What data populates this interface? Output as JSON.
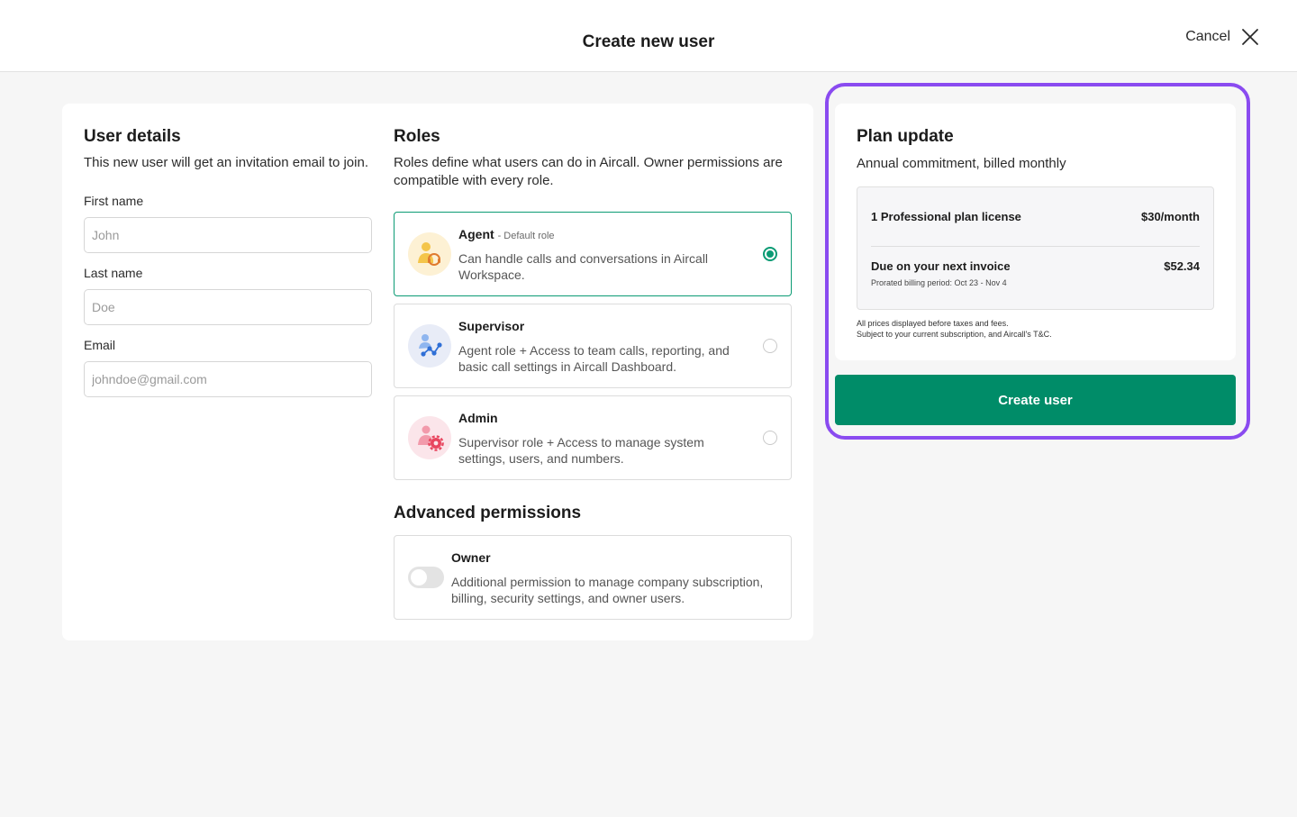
{
  "header": {
    "title": "Create new user",
    "cancel_label": "Cancel"
  },
  "user_details": {
    "title": "User details",
    "description": "This new user will get an invitation email to join.",
    "fields": {
      "first_name": {
        "label": "First name",
        "placeholder": "John",
        "value": ""
      },
      "last_name": {
        "label": "Last name",
        "placeholder": "Doe",
        "value": ""
      },
      "email": {
        "label": "Email",
        "placeholder": "johndoe@gmail.com",
        "value": ""
      }
    }
  },
  "roles": {
    "title": "Roles",
    "description": "Roles define what users can do in Aircall. Owner permissions are compatible with every role.",
    "items": [
      {
        "name": "Agent",
        "tag": "- Default role",
        "description": "Can handle calls and conversations in Aircall Workspace.",
        "selected": true,
        "icon": "agent-headset-icon"
      },
      {
        "name": "Supervisor",
        "tag": "",
        "description": "Agent role + Access to team calls, reporting, and basic call settings in Aircall Dashboard.",
        "selected": false,
        "icon": "supervisor-network-icon"
      },
      {
        "name": "Admin",
        "tag": "",
        "description": "Supervisor role + Access to manage system settings, users, and numbers.",
        "selected": false,
        "icon": "admin-gear-icon"
      }
    ]
  },
  "advanced_permissions": {
    "title": "Advanced permissions",
    "owner": {
      "name": "Owner",
      "description": "Additional permission to manage company subscription, billing, security settings, and owner users.",
      "enabled": false
    }
  },
  "plan_update": {
    "title": "Plan update",
    "subtitle": "Annual commitment, billed monthly",
    "license_label": "1 Professional plan license",
    "license_price": "$30/month",
    "due_label": "Due on your next invoice",
    "due_amount": "$52.34",
    "prorated": "Prorated billing period: Oct 23 - Nov 4",
    "disclaimer_line1": "All prices displayed before taxes and fees.",
    "disclaimer_line2": "Subject to your current subscription, and Aircall's T&C."
  },
  "actions": {
    "create_label": "Create user"
  },
  "colors": {
    "accent_green": "#008c68",
    "selected_border": "#0b9b74",
    "highlight_purple": "#8a4bf0"
  }
}
